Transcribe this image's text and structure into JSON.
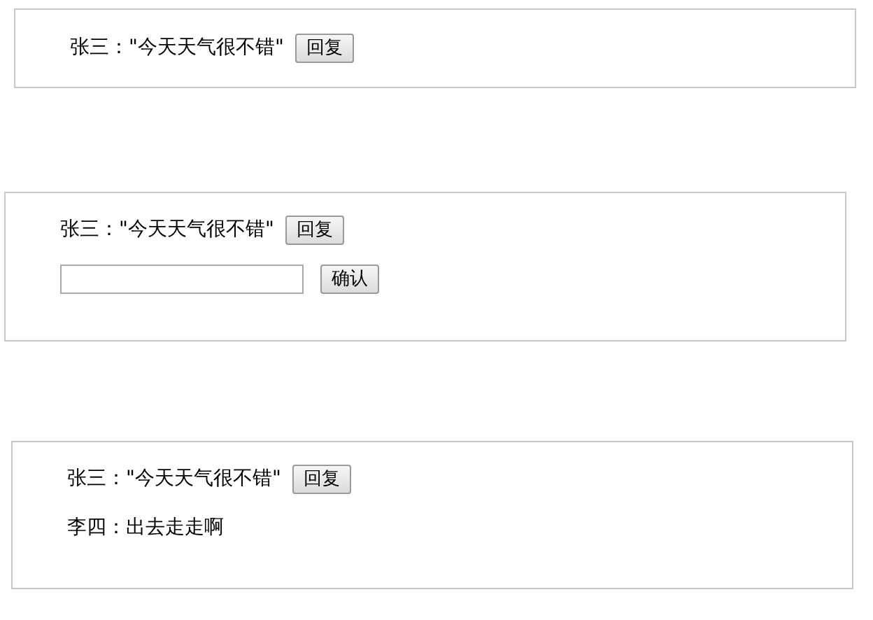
{
  "panels": [
    {
      "comment": "张三：\"今天天气很不错\"",
      "reply_button": "回复"
    },
    {
      "comment": "张三：\"今天天气很不错\"",
      "reply_button": "回复",
      "reply_form": {
        "confirm_button": "确认"
      }
    },
    {
      "comment": "张三：\"今天天气很不错\"",
      "reply_button": "回复",
      "replies": [
        "李四：出去走走啊"
      ]
    }
  ]
}
